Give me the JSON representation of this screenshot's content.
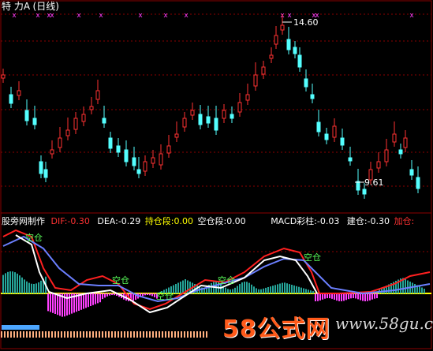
{
  "header": {
    "title": "特  力A",
    "period": "(日线)"
  },
  "price_panel": {
    "high_label": "14.60",
    "low_label": "9.61",
    "markers_count_text": ""
  },
  "indicator": {
    "name": "股旁网制作",
    "dif": "DIF:-0.30",
    "dea": "DEA:-0.29",
    "hold": "持仓段:0.00",
    "empty": "空仓段:0.00",
    "macd": "MACD彩柱:-0.03",
    "build": "建仓:-0.30",
    "add": "加仓:",
    "signal_labels": [
      "空仓",
      "空仓",
      "空仓",
      "空仓",
      "空仓"
    ]
  },
  "watermark": {
    "brand": "58公式网",
    "site": "www.58gu.com"
  },
  "colors": {
    "up": "#ff3232",
    "down": "#54ffff",
    "grid": "#8b0000",
    "dif": "#ff2020",
    "dea": "#6b7fff",
    "fast": "#ffffff",
    "zero": "#ffff00",
    "macd_pos": "#26a69a",
    "macd_neg": "#ff40ff",
    "marker": "#ff40ff"
  }
}
